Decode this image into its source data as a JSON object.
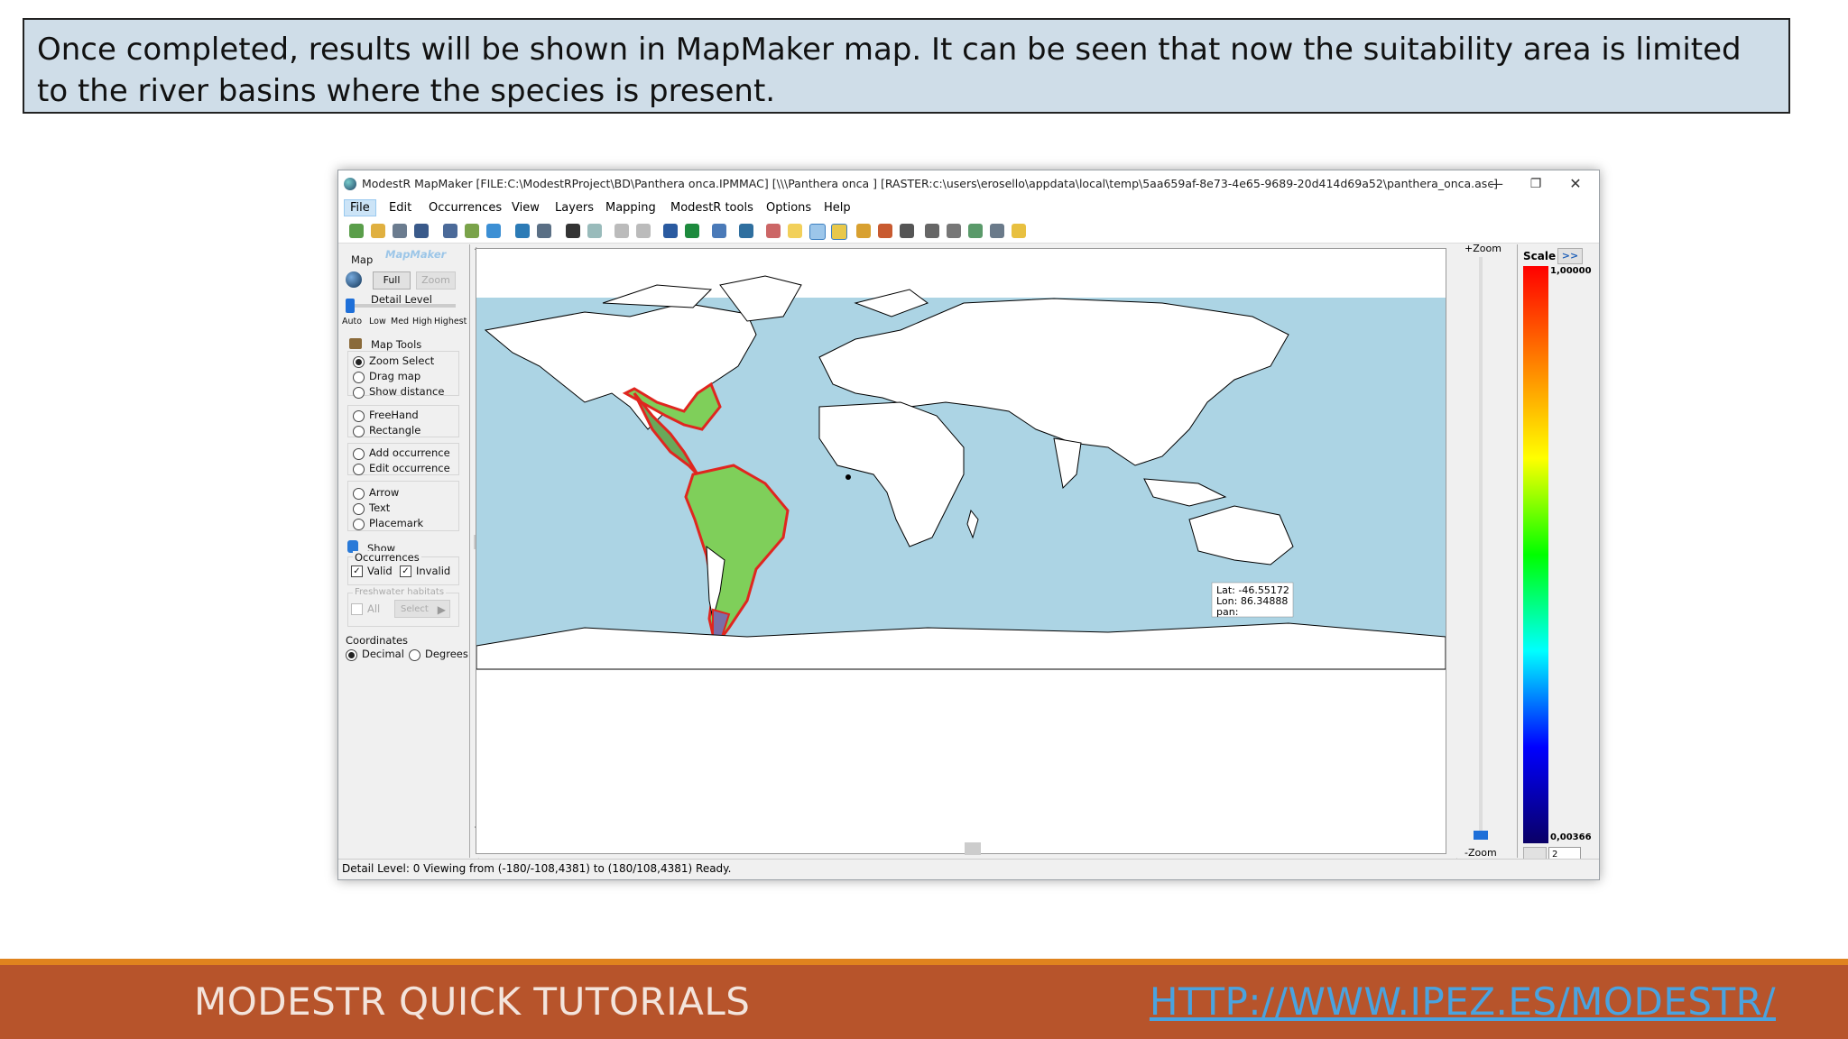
{
  "slide": {
    "callout_text": "Once completed, results will be shown in MapMaker map. It can be seen that now the suitability area is limited to the river basins where the species is present.",
    "footer_left": "MODESTR QUICK TUTORIALS",
    "footer_right": "HTTP://WWW.IPEZ.ES/MODESTR/",
    "colors": {
      "callout_bg": "#cfdde8",
      "footer_bg": "#b7542b",
      "footer_accent": "#e0831e",
      "link": "#4aa3df"
    }
  },
  "window": {
    "title": "ModestR MapMaker [FILE:C:\\ModestRProject\\BD\\Panthera onca.IPMMAC] [\\\\\\Panthera onca ] [RASTER:c:\\users\\erosello\\appdata\\local\\temp\\5aa659af-8e73-4e65-9689-20d414d69a52\\panthera_onca.asc]",
    "controls": {
      "minimize": "—",
      "restore": "❐",
      "close": "✕"
    }
  },
  "menu": [
    "File",
    "Edit",
    "Occurrences",
    "View",
    "Layers",
    "Mapping",
    "ModestR tools",
    "Options",
    "Help"
  ],
  "left_panel": {
    "map_label": "Map",
    "logo_text": "MapMaker",
    "full_button": "Full",
    "zoom_button": "Zoom",
    "detail_level_label": "Detail Level",
    "detail_levels": [
      "Auto",
      "Low",
      "Med",
      "High",
      "Highest"
    ],
    "map_tools_label": "Map Tools",
    "tools_group1": [
      "Zoom Select",
      "Drag map",
      "Show distance"
    ],
    "tools_group2": [
      "FreeHand",
      "Rectangle"
    ],
    "tools_group3": [
      "Add occurrence",
      "Edit occurrence"
    ],
    "tools_group4": [
      "Arrow",
      "Text",
      "Placemark"
    ],
    "selected_tool": "Zoom Select",
    "show_label": "Show",
    "occurrences_label": "Occurrences",
    "valid_label": "Valid",
    "invalid_label": "Invalid",
    "valid_checked": true,
    "invalid_checked": true,
    "freshwater_label": "Freshwater habitats",
    "all_label": "All",
    "select_button": "Select",
    "coordinates_label": "Coordinates",
    "decimal_label": "Decimal",
    "degrees_label": "Degrees",
    "coordinates_selected": "Decimal"
  },
  "map": {
    "zoom_plus": "+Zoom",
    "zoom_minus": "-Zoom",
    "tooltip_lat": "Lat: -46.55172",
    "tooltip_lon": "Lon: 86.34888",
    "tooltip_pan": "pan:"
  },
  "scale": {
    "title": "Scale",
    "expand": ">>",
    "max": "1,00000",
    "min": "0,00366",
    "spinner_value": "2"
  },
  "statusbar": {
    "text": "Detail Level: 0  Viewing from (-180/-108,4381) to (180/108,4381)  Ready."
  }
}
